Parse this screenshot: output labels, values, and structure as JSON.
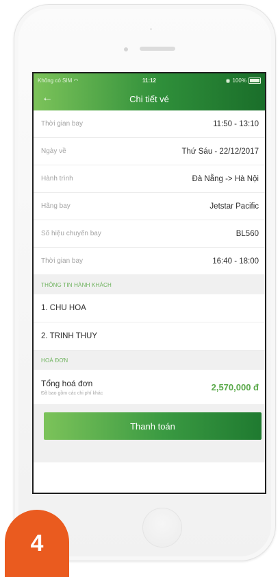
{
  "status_bar": {
    "carrier": "Không có SIM",
    "time": "11:12",
    "battery": "100%"
  },
  "header": {
    "title": "Chi tiết vé"
  },
  "flight_rows": [
    {
      "label": "Thời gian bay",
      "value": "11:50 - 13:10"
    },
    {
      "label": "Ngày về",
      "value": "Thứ Sáu - 22/12/2017"
    },
    {
      "label": "Hành trình",
      "value": "Đà Nẵng -> Hà Nội"
    },
    {
      "label": "Hãng bay",
      "value": "Jetstar Pacific"
    },
    {
      "label": "Số hiệu chuyến bay",
      "value": "BL560"
    },
    {
      "label": "Thời gian bay",
      "value": "16:40 - 18:00"
    }
  ],
  "passengers": {
    "section_title": "THÔNG TIN HÀNH KHÁCH",
    "items": [
      "1. CHU HOA",
      "2. TRINH THUY"
    ]
  },
  "invoice": {
    "section_title": "HOÁ ĐƠN",
    "total_label": "Tổng hoá đơn",
    "note": "Đã bao gồm các chi phí khác",
    "total_value": "2,570,000 đ"
  },
  "pay_button": "Thanh toán",
  "step_number": "4",
  "colors": {
    "accent_green": "#2f8f3a",
    "light_green": "#7cc35a",
    "badge_orange": "#ea5b1f"
  }
}
